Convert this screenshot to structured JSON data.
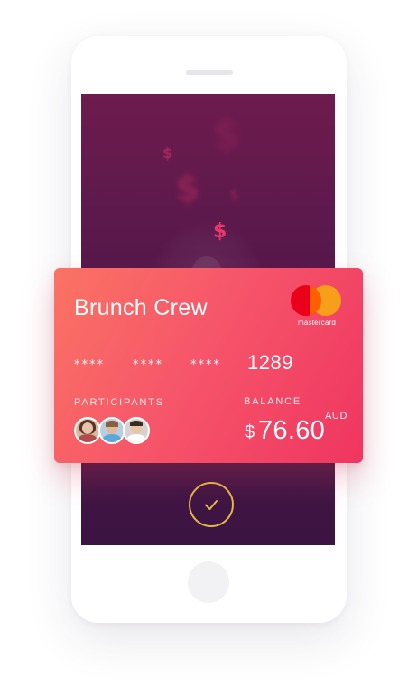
{
  "card": {
    "title": "Brunch Crew",
    "brand": "mastercard",
    "masked_groups": [
      "****",
      "****",
      "****"
    ],
    "last4": "1289",
    "participants_label": "PARTICIPANTS",
    "balance_label": "BALANCE",
    "currency": "AUD",
    "currency_symbol": "$",
    "balance": "76.60",
    "participants": [
      "avatar",
      "avatar",
      "avatar"
    ]
  },
  "screen": {
    "dollar_signs": [
      "$",
      "$",
      "$",
      "$",
      "$"
    ],
    "confirm_icon": "checkmark-icon"
  },
  "colors": {
    "card_gradient_start": "#fb7363",
    "card_gradient_end": "#ef3560",
    "screen_top": "#6e1b4e",
    "screen_bottom": "#3b1442",
    "confirm_ring": "#e3b946",
    "mastercard_red": "#eb001b",
    "mastercard_orange": "#f79e1b"
  }
}
